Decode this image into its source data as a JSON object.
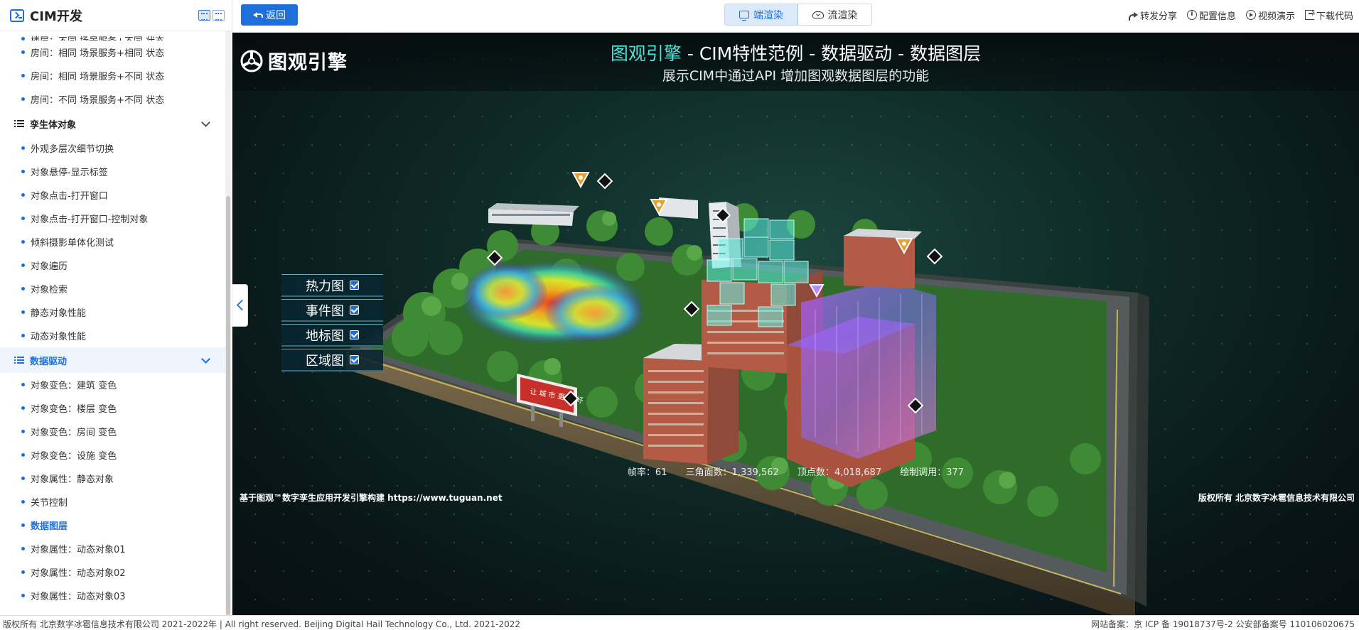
{
  "sidebar": {
    "title": "CIM开发",
    "partial_top_item": "楼层：不同 场景服务+不同 状态",
    "items_top": [
      {
        "label": "房间：相同 场景服务+相同 状态"
      },
      {
        "label": "房间：相同 场景服务+不同 状态"
      },
      {
        "label": "房间：不同 场景服务+不同 状态"
      }
    ],
    "group_twin": {
      "label": "孪生体对象",
      "items": [
        {
          "label": "外观多层次细节切换"
        },
        {
          "label": "对象悬停-显示标签"
        },
        {
          "label": "对象点击-打开窗口"
        },
        {
          "label": "对象点击-打开窗口-控制对象"
        },
        {
          "label": "倾斜摄影单体化测试"
        },
        {
          "label": "对象遍历"
        },
        {
          "label": "对象检索"
        },
        {
          "label": "静态对象性能"
        },
        {
          "label": "动态对象性能"
        }
      ]
    },
    "group_data": {
      "label": "数据驱动",
      "items": [
        {
          "label": "对象变色：建筑 变色"
        },
        {
          "label": "对象变色：楼层 变色"
        },
        {
          "label": "对象变色：房间 变色"
        },
        {
          "label": "对象变色：设施 变色"
        },
        {
          "label": "对象属性：静态对象"
        },
        {
          "label": "关节控制"
        },
        {
          "label": "数据图层",
          "active": true
        },
        {
          "label": "对象属性：动态对象01"
        },
        {
          "label": "对象属性：动态对象02"
        },
        {
          "label": "对象属性：动态对象03"
        }
      ]
    }
  },
  "topbar": {
    "back_label": "返回",
    "render_tabs": [
      {
        "label": "端渲染",
        "active": true,
        "icon": "monitor-icon"
      },
      {
        "label": "流渲染",
        "active": false,
        "icon": "cloud-icon"
      }
    ],
    "actions": [
      {
        "label": "转发分享",
        "icon": "share-icon"
      },
      {
        "label": "配置信息",
        "icon": "info-icon"
      },
      {
        "label": "视频演示",
        "icon": "play-icon"
      },
      {
        "label": "下载代码",
        "icon": "download-icon"
      }
    ]
  },
  "viewport": {
    "brand": "图观引擎",
    "title_highlight": "图观引擎",
    "title_rest": " - CIM特性范例 - 数据驱动 - 数据图层",
    "subtitle": "展示CIM中通过API 增加图观数据图层的功能",
    "layers": [
      {
        "label": "热力图",
        "checked": true
      },
      {
        "label": "事件图",
        "checked": true
      },
      {
        "label": "地标图",
        "checked": true
      },
      {
        "label": "区域图",
        "checked": true
      }
    ],
    "billboard_text": "让 城 市 更 美 好",
    "stats": {
      "fps_label": "帧率：",
      "fps": "61",
      "tri_label": "三角面数：",
      "triangles": "1,339,562",
      "vert_label": "顶点数：",
      "vertices": "4,018,687",
      "draw_label": "绘制调用：",
      "draw_calls": "377"
    },
    "footer_left": "基于图观™数字孪生应用开发引擎构建 https://www.tuguan.net",
    "footer_right": "版权所有 北京数字冰雹信息技术有限公司"
  },
  "footer": {
    "left": "版权所有 北京数字冰雹信息技术有限公司 2021-2022年 | All right reserved. Beijing Digital Hail Technology Co., Ltd. 2021-2022",
    "right": "网站备案：京 ICP 备 19018737号-2 公安部备案号 110106020675"
  },
  "colors": {
    "accent": "#1e6fd9",
    "title_highlight": "#4fe3d8",
    "viewport_bg": "#0f2b27"
  }
}
